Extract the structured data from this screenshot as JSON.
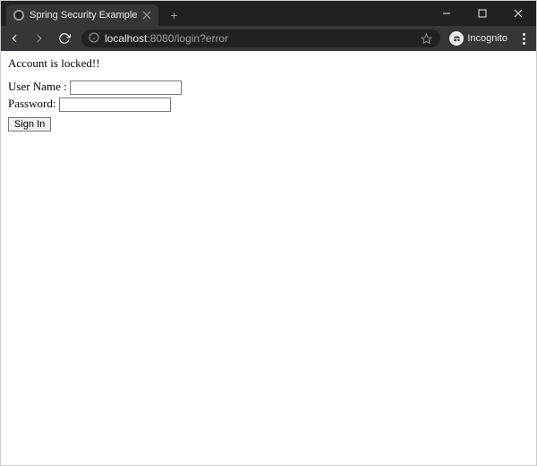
{
  "browser": {
    "tab_title": "Spring Security Example",
    "url_host": "localhost",
    "url_port": ":8080",
    "url_path": "/login?error",
    "incognito_label": "Incognito"
  },
  "page": {
    "error_message": "Account is locked!!",
    "username_label": "User Name :",
    "password_label": "Password:",
    "username_value": "",
    "password_value": "",
    "submit_label": "Sign In"
  }
}
